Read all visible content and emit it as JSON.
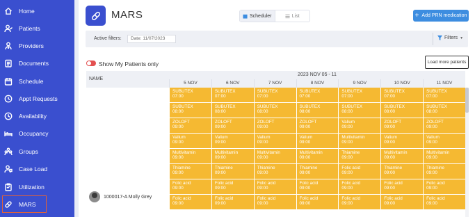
{
  "sidebar": {
    "items": [
      {
        "label": "Home",
        "icon": "home-icon"
      },
      {
        "label": "Patients",
        "icon": "patients-icon"
      },
      {
        "label": "Providers",
        "icon": "providers-icon"
      },
      {
        "label": "Documents",
        "icon": "documents-icon"
      },
      {
        "label": "Schedule",
        "icon": "schedule-icon"
      },
      {
        "label": "Appt Requests",
        "icon": "clock-icon"
      },
      {
        "label": "Availability",
        "icon": "clock-icon"
      },
      {
        "label": "Occupancy",
        "icon": "bed-icon"
      },
      {
        "label": "Groups",
        "icon": "groups-icon"
      },
      {
        "label": "Case Load",
        "icon": "case-load-icon"
      },
      {
        "label": "Utilization",
        "icon": "clipboard-icon"
      },
      {
        "label": "MARS",
        "icon": "pill-icon"
      }
    ],
    "active": "MARS"
  },
  "header": {
    "title": "MARS",
    "view_toggle": {
      "scheduler": "Scheduler",
      "list": "List",
      "selected": "Scheduler"
    },
    "add_button": "Add PRN medication"
  },
  "filters": {
    "label": "Active filters:",
    "date_chip": "Date: 11/07/2023",
    "filters_button": "Filters"
  },
  "toggle": {
    "label": "Show My Patients only",
    "on": true
  },
  "load_more": "Load more patients",
  "table": {
    "name_header": "NAME",
    "date_range": "2023 NOV 05 - 11",
    "days": [
      "5 NOV",
      "6 NOV",
      "7 NOV",
      "8 NOV",
      "9 NOV",
      "10 NOV",
      "11 NOV"
    ],
    "patient": {
      "name": "1000017-A Molly Grey"
    },
    "rows": [
      [
        [
          "SUBUTEX",
          "07:00"
        ],
        [
          "SUBUTEX",
          "07:00"
        ],
        [
          "SUBUTEX",
          "07:00"
        ],
        [
          "SUBUTEX",
          "07:00"
        ],
        [
          "SUBUTEX",
          "07:00"
        ],
        [
          "SUBUTEX",
          "07:00"
        ],
        [
          "SUBUTEX",
          "07:00"
        ]
      ],
      [
        [
          "SUBUTEX",
          "08:00"
        ],
        [
          "SUBUTEX",
          "08:00"
        ],
        [
          "SUBUTEX",
          "08:00"
        ],
        [
          "SUBUTEX",
          "08:00"
        ],
        [
          "SUBUTEX",
          "08:00"
        ],
        [
          "SUBUTEX",
          "08:00"
        ],
        [
          "SUBUTEX",
          "08:00"
        ]
      ],
      [
        [
          "ZOLOFT",
          "09:00"
        ],
        [
          "ZOLOFT",
          "09:00"
        ],
        [
          "ZOLOFT",
          "09:00"
        ],
        [
          "ZOLOFT",
          "09:00"
        ],
        [
          "Valium",
          "09:00"
        ],
        [
          "ZOLOFT",
          "09:00"
        ],
        [
          "ZOLOFT",
          "09:00"
        ]
      ],
      [
        [
          "Valium",
          "09:00"
        ],
        [
          "Valium",
          "09:00"
        ],
        [
          "Valium",
          "09:00"
        ],
        [
          "Valium",
          "09:00"
        ],
        [
          "Multivitamin",
          "09:00"
        ],
        [
          "Valium",
          "09:00"
        ],
        [
          "Valium",
          "09:00"
        ]
      ],
      [
        [
          "Multivitamin",
          "09:00"
        ],
        [
          "Multivitamin",
          "09:00"
        ],
        [
          "Multivitamin",
          "09:00"
        ],
        [
          "Multivitamin",
          "09:00"
        ],
        [
          "Thiamine",
          "09:00"
        ],
        [
          "Multivitamin",
          "09:00"
        ],
        [
          "Multivitamin",
          "09:00"
        ]
      ],
      [
        [
          "Thiamine",
          "09:00"
        ],
        [
          "Thiamine",
          "09:00"
        ],
        [
          "Thiamine",
          "09:00"
        ],
        [
          "Thiamine",
          "09:00"
        ],
        [
          "Folic acid",
          "09:00"
        ],
        [
          "Thiamine",
          "09:00"
        ],
        [
          "Thiamine",
          "09:00"
        ]
      ],
      [
        [
          "Folic acid",
          "09:00"
        ],
        [
          "Folic acid",
          "09:00"
        ],
        [
          "Folic acid",
          "09:00"
        ],
        [
          "Folic acid",
          "09:00"
        ],
        [
          "Folic acid",
          "09:00"
        ],
        [
          "Folic acid",
          "09:00"
        ],
        [
          "Folic acid",
          "09:00"
        ]
      ],
      [
        [
          "Folic acid",
          "09:00"
        ],
        [
          "Folic acid",
          "09:00"
        ],
        [
          "Folic acid",
          "09:00"
        ],
        [
          "Folic acid",
          "09:00"
        ],
        [
          "Folic acid",
          "09:00"
        ],
        [
          "Folic acid",
          "09:00"
        ],
        [
          "Folic acid",
          "09:00"
        ]
      ]
    ]
  },
  "colors": {
    "sidebar": "#3a4fcf",
    "med_cell": "#f5b932",
    "accent": "#3d8de0",
    "active_outline": "#e0623a"
  }
}
